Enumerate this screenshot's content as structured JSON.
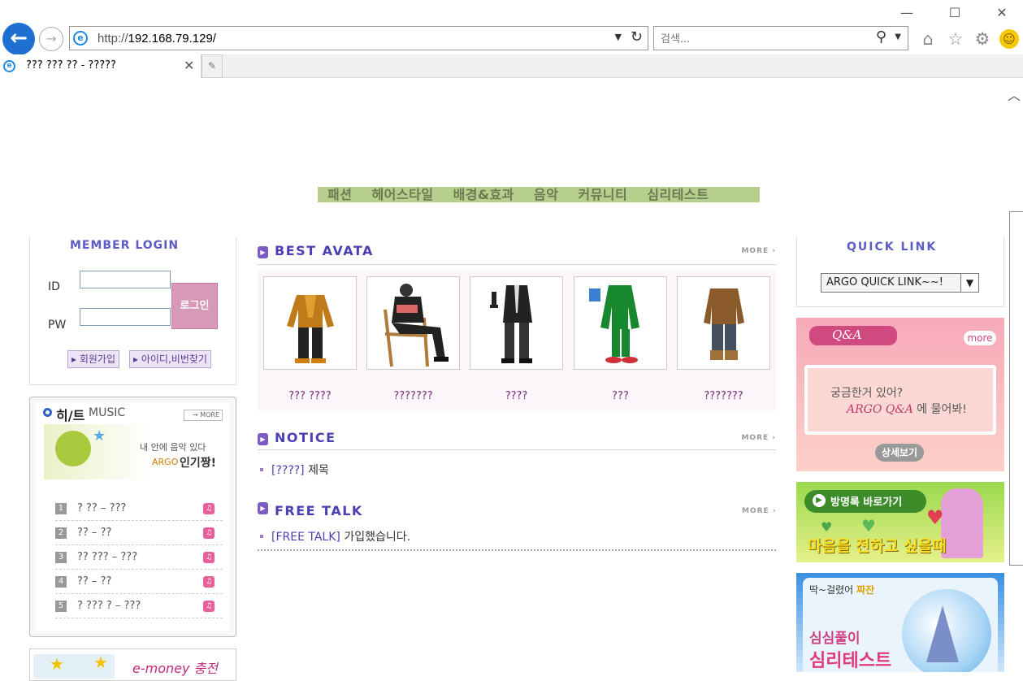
{
  "browser": {
    "url_prefix": "http://",
    "url_host": "192.168.79.129/",
    "search_placeholder": "검색...",
    "tab_title": "??? ??? ?? - ?????"
  },
  "menu": [
    "패션",
    "헤어스타일",
    "배경&효과",
    "음악",
    "커뮤니티",
    "심리테스트"
  ],
  "login": {
    "title": "MEMBER LOGIN",
    "id_label": "ID",
    "pw_label": "PW",
    "login_button": "로그인",
    "join_button": "회원가입",
    "find_button": "아이디,비번찾기"
  },
  "music": {
    "title_ko": "히/트",
    "title_en": "MUSIC",
    "more": "MORE",
    "banner_line1": "내 안에 음악 있다",
    "banner_brand": "ARGO",
    "banner_line2": "인기짱!",
    "items": [
      {
        "num": "1",
        "title": "? ?? – ???"
      },
      {
        "num": "2",
        "title": "?? – ??"
      },
      {
        "num": "3",
        "title": "?? ??? – ???"
      },
      {
        "num": "4",
        "title": "?? – ??"
      },
      {
        "num": "5",
        "title": "? ??? ? – ???"
      }
    ]
  },
  "emoney": {
    "text": "e-money 충전"
  },
  "best_avata": {
    "title": "BEST AVATA",
    "more": "MORE",
    "items": [
      {
        "label": "??? ????"
      },
      {
        "label": "???????"
      },
      {
        "label": "????"
      },
      {
        "label": "???"
      },
      {
        "label": "???????"
      }
    ]
  },
  "notice": {
    "title": "NOTICE",
    "more": "MORE",
    "items": [
      {
        "tag": "[????]",
        "text": "제목"
      }
    ]
  },
  "free_talk": {
    "title": "FREE TALK",
    "more": "MORE",
    "items": [
      {
        "tag": "[FREE TALK]",
        "text": "가입했습니다."
      }
    ]
  },
  "quick_link": {
    "title": "QUICK LINK",
    "selected": "ARGO QUICK LINK~~!"
  },
  "qna": {
    "title": "Q&A",
    "more": "more",
    "line1": "궁금한거 있어?",
    "line2_brand": "ARGO Q&A",
    "line2_rest": "에 물어봐!",
    "button": "상세보기"
  },
  "guestbook": {
    "button": "방명록 바로가기",
    "text": "마음을 전하고 싶을때"
  },
  "psych": {
    "line1": "딱~걸렸어",
    "line1_hl": "짜잔",
    "line2": "심심풀이",
    "line3": "심리테스트"
  },
  "colors": {
    "menu_bg": "#b7cf8d",
    "accent_purple": "#4b3fb3",
    "qna_pink": "#f5a4b4",
    "guestbook_green": "#8bcf3a",
    "psych_blue": "#3b8fe0"
  }
}
